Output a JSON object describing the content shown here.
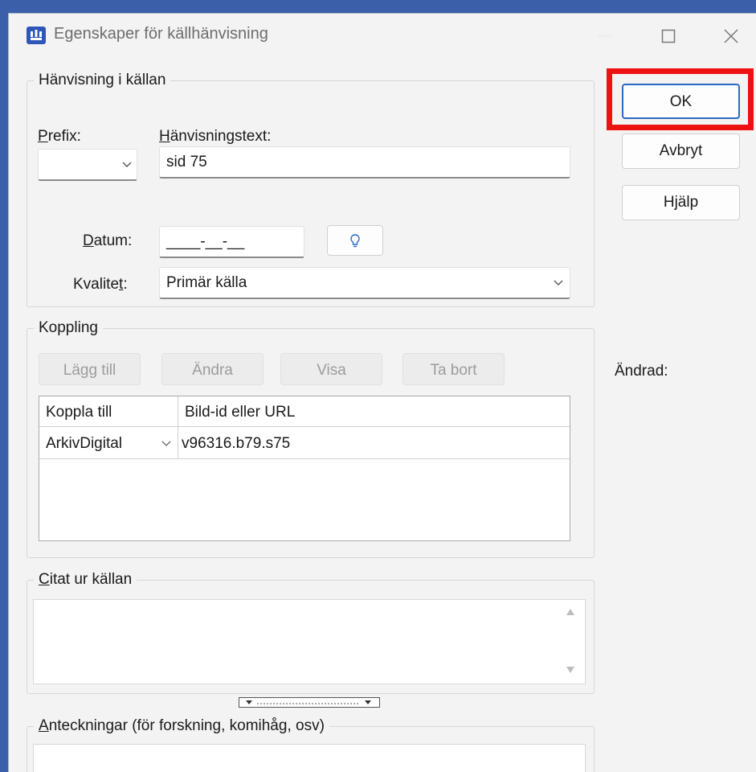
{
  "window": {
    "title": "Egenskaper för källhänvisning"
  },
  "reference": {
    "group_label": "Hänvisning i källan",
    "prefix_label": "Prefix:",
    "prefix_value": "",
    "text_label": "Hänvisningstext:",
    "text_value": "sid 75",
    "date_label": "Datum:",
    "date_value": "____-__-__",
    "quality_label": "Kvalitet:",
    "quality_value": "Primär källa"
  },
  "buttons": {
    "ok": "OK",
    "cancel": "Avbryt",
    "help": "Hjälp"
  },
  "changed_label": "Ändrad:",
  "link": {
    "group_label": "Koppling",
    "add": "Lägg till",
    "edit": "Ändra",
    "view": "Visa",
    "remove": "Ta bort",
    "columns": [
      "Koppla till",
      "Bild-id eller URL"
    ],
    "rows": [
      {
        "target": "ArkivDigital",
        "url": "v96316.b79.s75"
      }
    ]
  },
  "quote": {
    "group_label": "Citat ur källan",
    "value": ""
  },
  "notes": {
    "group_label": "Anteckningar (för forskning, komihåg, osv)"
  },
  "colors": {
    "highlight": "#ee1111",
    "accent": "#2d68c4"
  }
}
